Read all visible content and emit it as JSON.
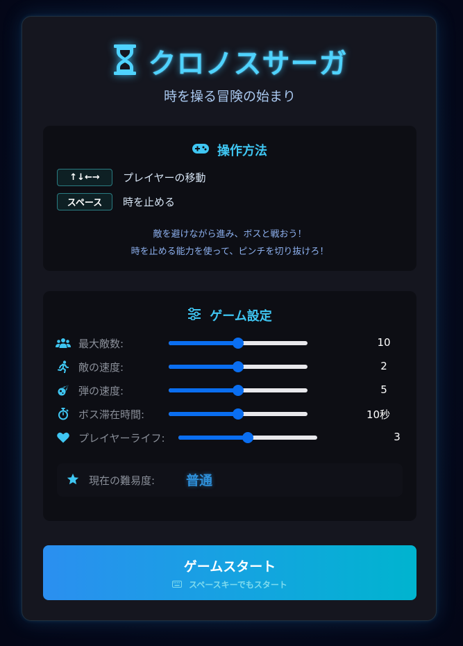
{
  "header": {
    "title": "クロノスサーガ",
    "subtitle": "時を操る冒険の始まり",
    "title_icon": "hourglass-icon"
  },
  "controls": {
    "heading": "操作方法",
    "heading_icon": "gamepad-icon",
    "keys": [
      {
        "key": "↑↓←→",
        "desc": "プレイヤーの移動"
      },
      {
        "key": "スペース",
        "desc": "時を止める"
      }
    ],
    "hint_lines": [
      "敵を避けながら進み、ボスと戦おう！",
      "時を止める能力を使って、ピンチを切り抜けろ！"
    ]
  },
  "settings": {
    "heading": "ゲーム設定",
    "heading_icon": "sliders-icon",
    "items": [
      {
        "icon": "users-icon",
        "label": "最大敵数:",
        "value": "10",
        "level": 0.5
      },
      {
        "icon": "running-icon",
        "label": "敵の速度:",
        "value": "2",
        "level": 0.5
      },
      {
        "icon": "meteor-icon",
        "label": "弾の速度:",
        "value": "5",
        "level": 0.5
      },
      {
        "icon": "stopwatch-icon",
        "label": "ボス滞在時間:",
        "value": "10秒",
        "level": 0.5
      },
      {
        "icon": "heart-icon",
        "label": "プレイヤーライフ:",
        "value": "3",
        "level": 0.5
      }
    ],
    "difficulty": {
      "icon": "star-icon",
      "label": "現在の難易度:",
      "level": "普通"
    }
  },
  "start": {
    "label": "ゲームスタート",
    "sub": "スペースキーでもスタート",
    "sub_icon": "keyboard-icon"
  },
  "colors": {
    "accent": "#3fc6f2",
    "slider": "#0a6ef0",
    "button_start": "#2b8ff0",
    "button_end": "#00b4cf"
  }
}
